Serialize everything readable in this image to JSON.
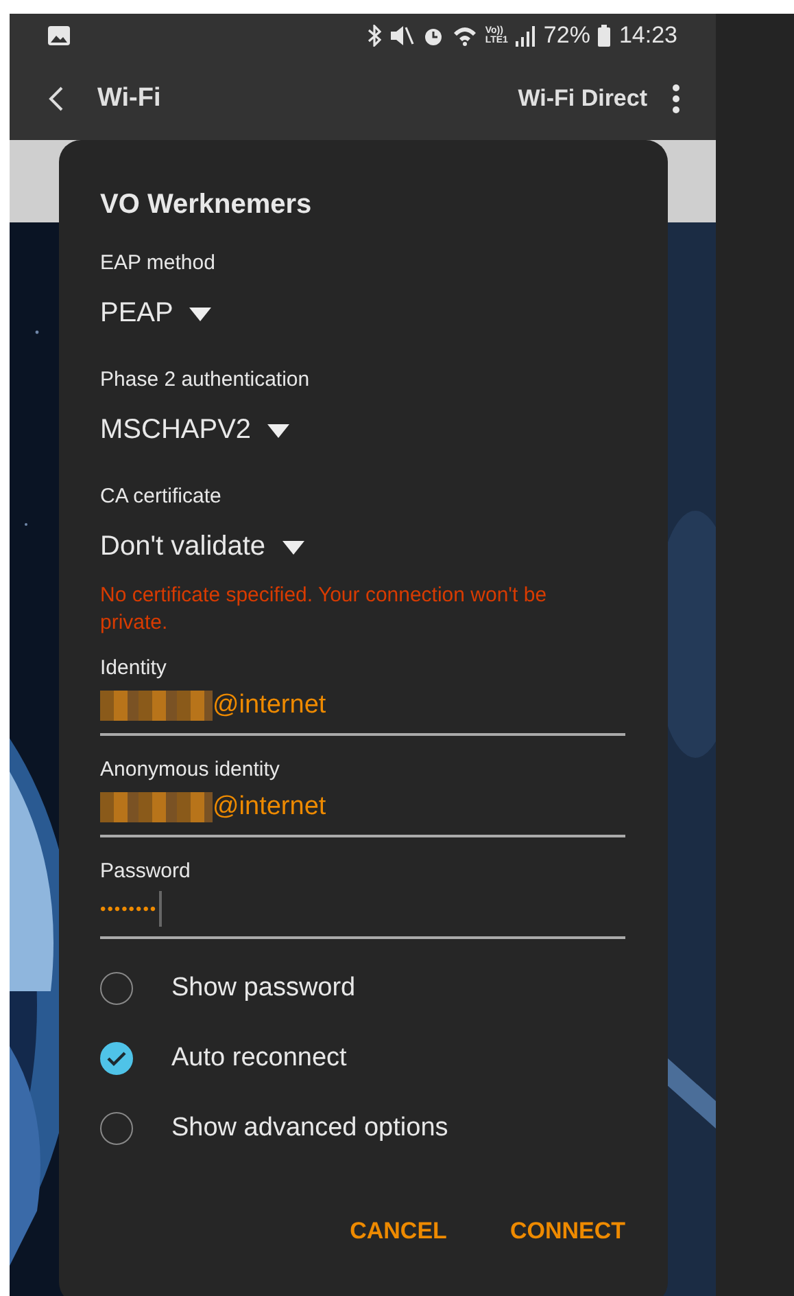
{
  "status_bar": {
    "network_label": [
      "Vo))",
      "LTE1"
    ],
    "battery": "72%",
    "time": "14:23"
  },
  "app_bar": {
    "title": "Wi-Fi",
    "action": "Wi-Fi Direct"
  },
  "dialog": {
    "title": "VO Werknemers",
    "fields": [
      {
        "kind": "dropdown",
        "label": "EAP method",
        "value": "PEAP"
      },
      {
        "kind": "dropdown",
        "label": "Phase 2 authentication",
        "value": "MSCHAPV2"
      },
      {
        "kind": "dropdown",
        "label": "CA certificate",
        "value": "Don't validate",
        "error": "No certificate specified. Your connection won't be private."
      },
      {
        "kind": "text",
        "label": "Identity",
        "value": "@internet",
        "redacted": true
      },
      {
        "kind": "text",
        "label": "Anonymous identity",
        "value": "@internet",
        "redacted": true
      },
      {
        "kind": "password",
        "label": "Password",
        "value": "••••••••",
        "focused": true
      }
    ],
    "options": [
      {
        "label": "Show password",
        "checked": false
      },
      {
        "label": "Auto reconnect",
        "checked": true
      },
      {
        "label": "Show advanced options",
        "checked": false
      }
    ],
    "buttons": [
      "CANCEL",
      "CONNECT"
    ]
  }
}
